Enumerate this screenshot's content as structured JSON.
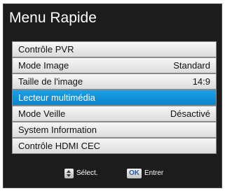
{
  "menu": {
    "title": "Menu Rapide",
    "items": [
      {
        "label": "Contrôle PVR",
        "value": ""
      },
      {
        "label": "Mode Image",
        "value": "Standard"
      },
      {
        "label": "Taille de l'image",
        "value": "14:9"
      },
      {
        "label": "Lecteur multimédia",
        "value": ""
      },
      {
        "label": "Mode Veille",
        "value": "Désactivé"
      },
      {
        "label": "System Information",
        "value": ""
      },
      {
        "label": "Contrôle HDMI CEC",
        "value": ""
      }
    ],
    "selected_index": 3
  },
  "footer": {
    "select_label": "Sélect.",
    "select_icon": "up-down-arrows-icon",
    "ok_key": "OK",
    "enter_label": "Entrer"
  },
  "colors": {
    "highlight": "#0a8fd8",
    "panel_bg": "#1c1c1c",
    "item_bg": "#ececec"
  }
}
